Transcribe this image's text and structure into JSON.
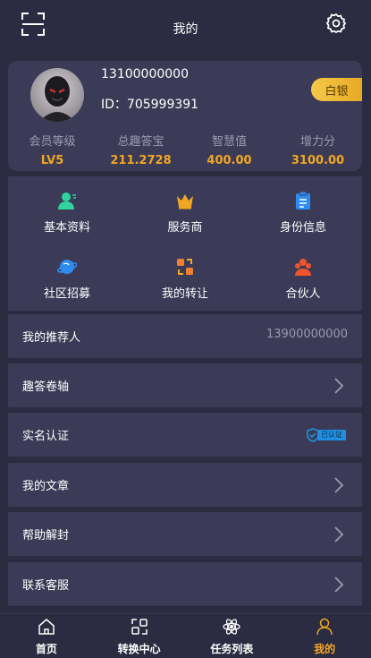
{
  "header": {
    "title": "我的"
  },
  "profile": {
    "phone": "13100000000",
    "id_text": "ID：705999391",
    "rank": "白银",
    "stats": [
      {
        "label": "会员等级",
        "value": "LV5"
      },
      {
        "label": "总趣答宝",
        "value": "211.2728"
      },
      {
        "label": "智慧值",
        "value": "400.00"
      },
      {
        "label": "增力分",
        "value": "3100.00"
      }
    ]
  },
  "grid": [
    {
      "label": "基本资料",
      "icon": "user-icon"
    },
    {
      "label": "服务商",
      "icon": "crown-icon"
    },
    {
      "label": "身份信息",
      "icon": "clipboard-icon"
    },
    {
      "label": "社区招募",
      "icon": "planet-icon"
    },
    {
      "label": "我的转让",
      "icon": "transfer-icon"
    },
    {
      "label": "合伙人",
      "icon": "team-icon"
    }
  ],
  "rows": {
    "referrer": {
      "label": "我的推荐人",
      "value": "13900000000"
    },
    "scroll": {
      "label": "趣答卷轴"
    },
    "realname": {
      "label": "实名认证",
      "badge": "已认证"
    },
    "articles": {
      "label": "我的文章"
    },
    "unlock": {
      "label": "帮助解封"
    },
    "support": {
      "label": "联系客服"
    }
  },
  "tabs": [
    {
      "label": "首页",
      "icon": "home-icon"
    },
    {
      "label": "转换中心",
      "icon": "exchange-icon"
    },
    {
      "label": "任务列表",
      "icon": "atom-icon"
    },
    {
      "label": "我的",
      "icon": "person-icon",
      "active": true
    }
  ],
  "colors": {
    "accent": "#f2a623",
    "background": "#2b2b41",
    "card": "#3b3b57",
    "verified": "#1f8fe0"
  }
}
